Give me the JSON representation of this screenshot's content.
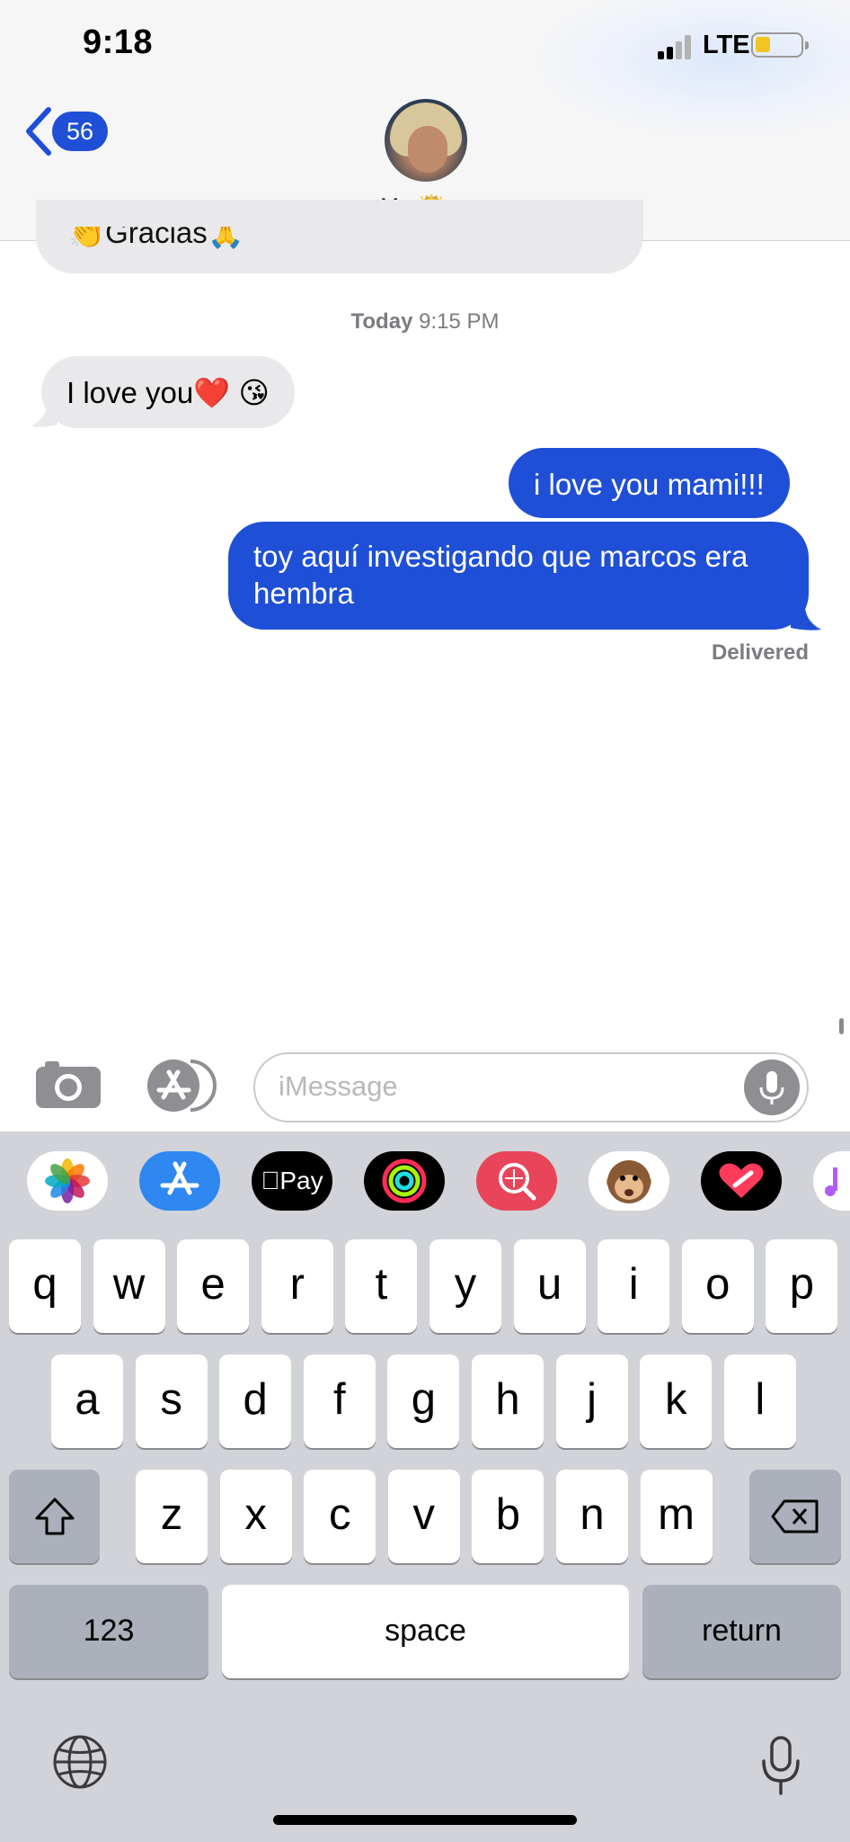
{
  "status_bar": {
    "time": "9:18",
    "network": "LTE",
    "battery_color": "#f2c523"
  },
  "header": {
    "back_count": "56",
    "contact_name": "Ma 👸🏼",
    "chevron": "›",
    "accent": "#1f4fd6"
  },
  "conversation": {
    "partial_previous": "👏Gracias🙏",
    "timestamp_day": "Today",
    "timestamp_time": "9:15 PM",
    "messages": [
      {
        "direction": "incoming",
        "text": "I love you❤️ 😘"
      },
      {
        "direction": "outgoing",
        "text": "i love you mami!!!"
      },
      {
        "direction": "outgoing",
        "text": "toy aquí investigando que marcos era hembra"
      }
    ],
    "delivered_label": "Delivered"
  },
  "compose": {
    "placeholder": "iMessage",
    "camera_icon": "camera-icon",
    "apps_icon": "app-store-icon",
    "mic_icon": "microphone-icon"
  },
  "app_strip": {
    "items": [
      "photos",
      "app-store",
      "apple-pay",
      "activity",
      "search-images",
      "animoji",
      "digital-touch",
      "music"
    ],
    "apple_pay_label": "Pay"
  },
  "keyboard": {
    "row1": [
      "q",
      "w",
      "e",
      "r",
      "t",
      "y",
      "u",
      "i",
      "o",
      "p"
    ],
    "row2": [
      "a",
      "s",
      "d",
      "f",
      "g",
      "h",
      "j",
      "k",
      "l"
    ],
    "row3": [
      "z",
      "x",
      "c",
      "v",
      "b",
      "n",
      "m"
    ],
    "numbers_label": "123",
    "space_label": "space",
    "return_label": "return"
  }
}
